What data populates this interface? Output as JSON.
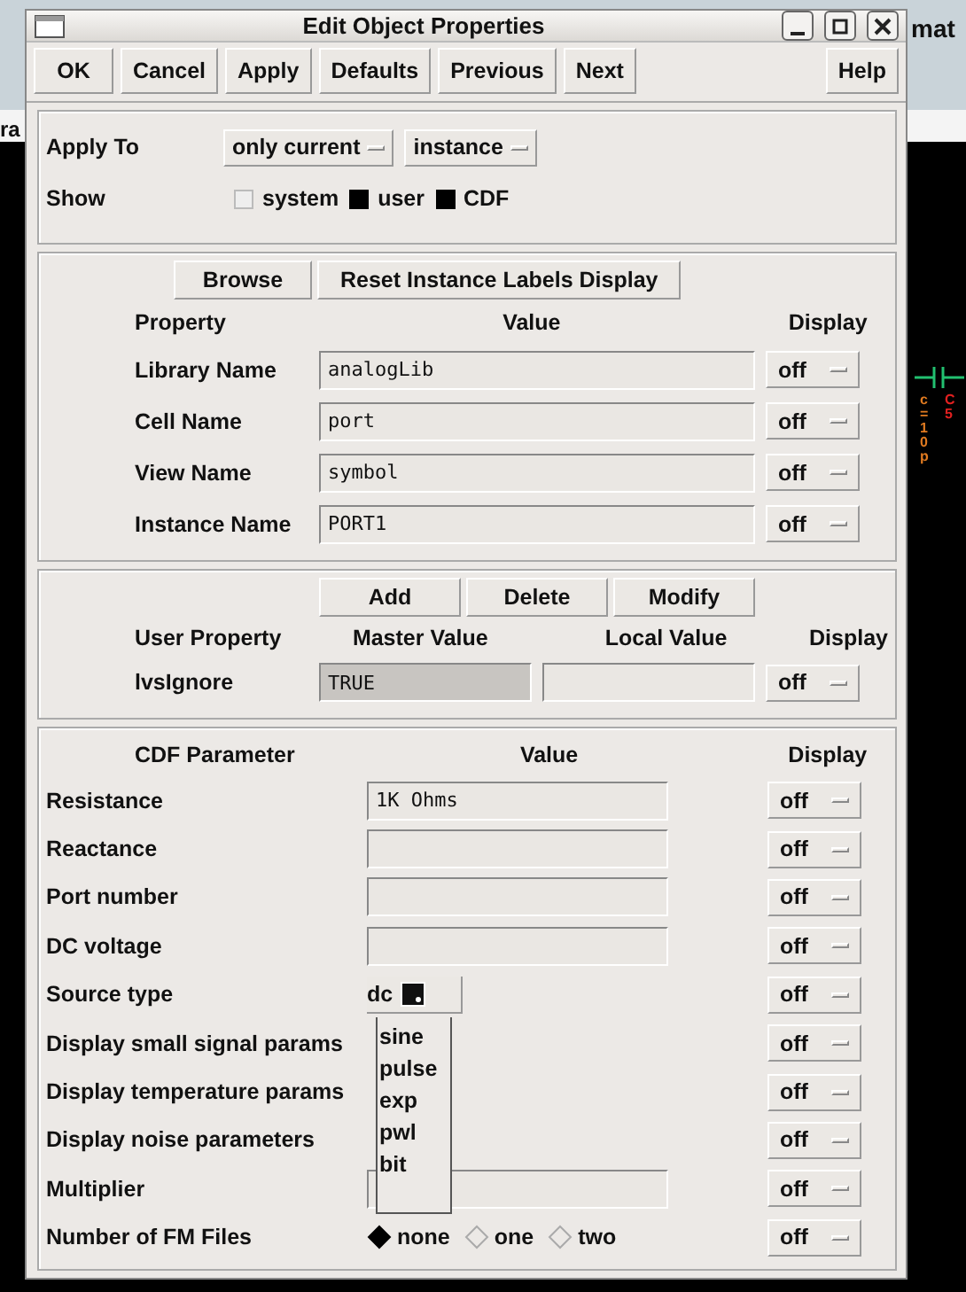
{
  "background": {
    "title_fragment": "mat",
    "menu_fragment": "ra",
    "component_value": "c=10p",
    "component_name": "C5"
  },
  "window": {
    "title": "Edit Object Properties"
  },
  "toolbar": [
    {
      "label": "OK"
    },
    {
      "label": "Cancel"
    },
    {
      "label": "Apply"
    },
    {
      "label": "Defaults"
    },
    {
      "label": "Previous"
    },
    {
      "label": "Next"
    },
    {
      "label": "Help"
    }
  ],
  "apply_to": {
    "label": "Apply To",
    "options": [
      "only current",
      "instance"
    ]
  },
  "show": {
    "label": "Show",
    "checkboxes": [
      {
        "label": "system",
        "checked": false
      },
      {
        "label": "user",
        "checked": true
      },
      {
        "label": "CDF",
        "checked": true
      }
    ]
  },
  "property_section": {
    "buttons": [
      "Browse",
      "Reset Instance Labels Display"
    ],
    "columns": [
      "Property",
      "Value",
      "Display"
    ],
    "rows": [
      {
        "name": "Library Name",
        "value": "analogLib",
        "display": "off"
      },
      {
        "name": "Cell Name",
        "value": "port",
        "display": "off"
      },
      {
        "name": "View Name",
        "value": "symbol",
        "display": "off"
      },
      {
        "name": "Instance Name",
        "value": "PORT1",
        "display": "off"
      }
    ]
  },
  "user_section": {
    "buttons": [
      "Add",
      "Delete",
      "Modify"
    ],
    "columns": [
      "User Property",
      "Master Value",
      "Local Value",
      "Display"
    ],
    "rows": [
      {
        "name": "lvsIgnore",
        "master_value": "TRUE",
        "display": "off"
      }
    ]
  },
  "cdf_section": {
    "columns": [
      "CDF Parameter",
      "Value",
      "Display"
    ],
    "rows": [
      {
        "kind": "field",
        "name": "Resistance",
        "value": "1K Ohms",
        "display": "off"
      },
      {
        "kind": "field",
        "name": "Reactance",
        "display": "off"
      },
      {
        "kind": "field",
        "name": "Port number",
        "display": "off"
      },
      {
        "kind": "field",
        "name": "DC voltage",
        "display": "off"
      },
      {
        "kind": "cycle",
        "name": "Source type",
        "value": "dc",
        "menu": [
          "sine",
          "pulse",
          "exp",
          "pwl",
          "bit"
        ],
        "display": "off"
      },
      {
        "kind": "blank",
        "name": "Display small signal params",
        "display": "off"
      },
      {
        "kind": "blank",
        "name": "Display temperature params",
        "display": "off"
      },
      {
        "kind": "blank",
        "name": "Display noise parameters",
        "display": "off"
      },
      {
        "kind": "field",
        "name": "Multiplier",
        "display": "off"
      },
      {
        "kind": "radio",
        "name": "Number of FM Files",
        "options": [
          {
            "label": "none",
            "selected": true
          },
          {
            "label": "one",
            "selected": false
          },
          {
            "label": "two",
            "selected": false
          }
        ],
        "display": "off"
      }
    ]
  }
}
